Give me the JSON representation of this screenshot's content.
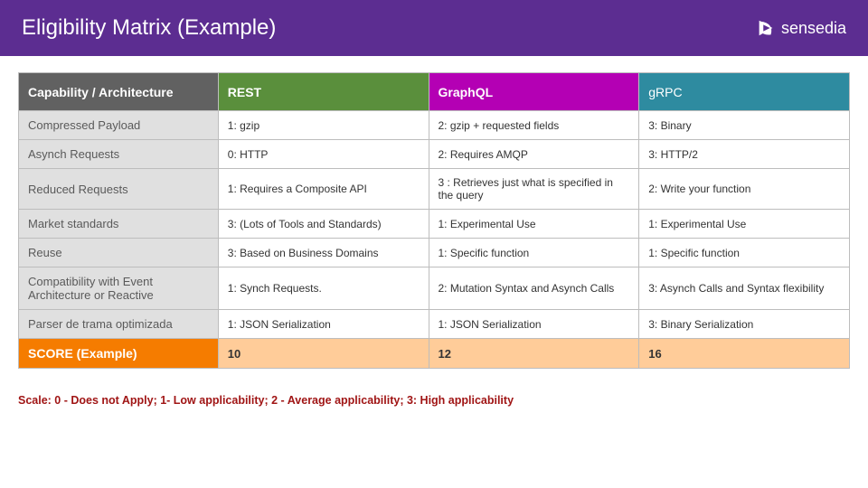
{
  "header": {
    "title": "Eligibility Matrix (Example)",
    "brand": "sensedia"
  },
  "table": {
    "headers": {
      "capability": "Capability / Architecture",
      "rest": "REST",
      "graphql": "GraphQL",
      "grpc": "gRPC"
    },
    "rows": [
      {
        "capability": "Compressed Payload",
        "rest": "1: gzip",
        "graphql": "2: gzip + requested fields",
        "grpc": "3: Binary"
      },
      {
        "capability": "Asynch Requests",
        "rest": "0: HTTP",
        "graphql": "2: Requires AMQP",
        "grpc": "3: HTTP/2"
      },
      {
        "capability": "Reduced Requests",
        "rest": "1: Requires a Composite API",
        "graphql": "3 : Retrieves just what is specified in the query",
        "grpc": "2: Write your function"
      },
      {
        "capability": "Market standards",
        "rest": "3: (Lots of Tools and Standards)",
        "graphql": "1: Experimental Use",
        "grpc": "1: Experimental Use"
      },
      {
        "capability": "Reuse",
        "rest": "3: Based on Business Domains",
        "graphql": "1: Specific function",
        "grpc": "1: Specific function"
      },
      {
        "capability": "Compatibility with Event Architecture or Reactive",
        "rest": "1: Synch Requests.",
        "graphql": "2: Mutation Syntax and Asynch Calls",
        "grpc": "3: Asynch Calls and Syntax flexibility"
      },
      {
        "capability": "Parser de trama optimizada",
        "rest": "1: JSON Serialization",
        "graphql": "1: JSON Serialization",
        "grpc": "3: Binary Serialization"
      }
    ],
    "score": {
      "label": "SCORE (Example)",
      "rest": "10",
      "graphql": "12",
      "grpc": "16"
    }
  },
  "legend": "Scale: 0 - Does not Apply; 1- Low applicability; 2 - Average applicability; 3: High applicability",
  "chart_data": {
    "type": "table",
    "title": "Eligibility Matrix (Example)",
    "columns": [
      "Capability / Architecture",
      "REST",
      "GraphQL",
      "gRPC"
    ],
    "rows": [
      [
        "Compressed Payload",
        1,
        2,
        3
      ],
      [
        "Asynch Requests",
        0,
        2,
        3
      ],
      [
        "Reduced Requests",
        1,
        3,
        2
      ],
      [
        "Market standards",
        3,
        1,
        1
      ],
      [
        "Reuse",
        3,
        1,
        1
      ],
      [
        "Compatibility with Event Architecture or Reactive",
        1,
        2,
        3
      ],
      [
        "Parser de trama optimizada",
        1,
        1,
        3
      ]
    ],
    "totals": {
      "REST": 10,
      "GraphQL": 12,
      "gRPC": 16
    },
    "scale": {
      "0": "Does not Apply",
      "1": "Low applicability",
      "2": "Average applicability",
      "3": "High applicability"
    }
  }
}
